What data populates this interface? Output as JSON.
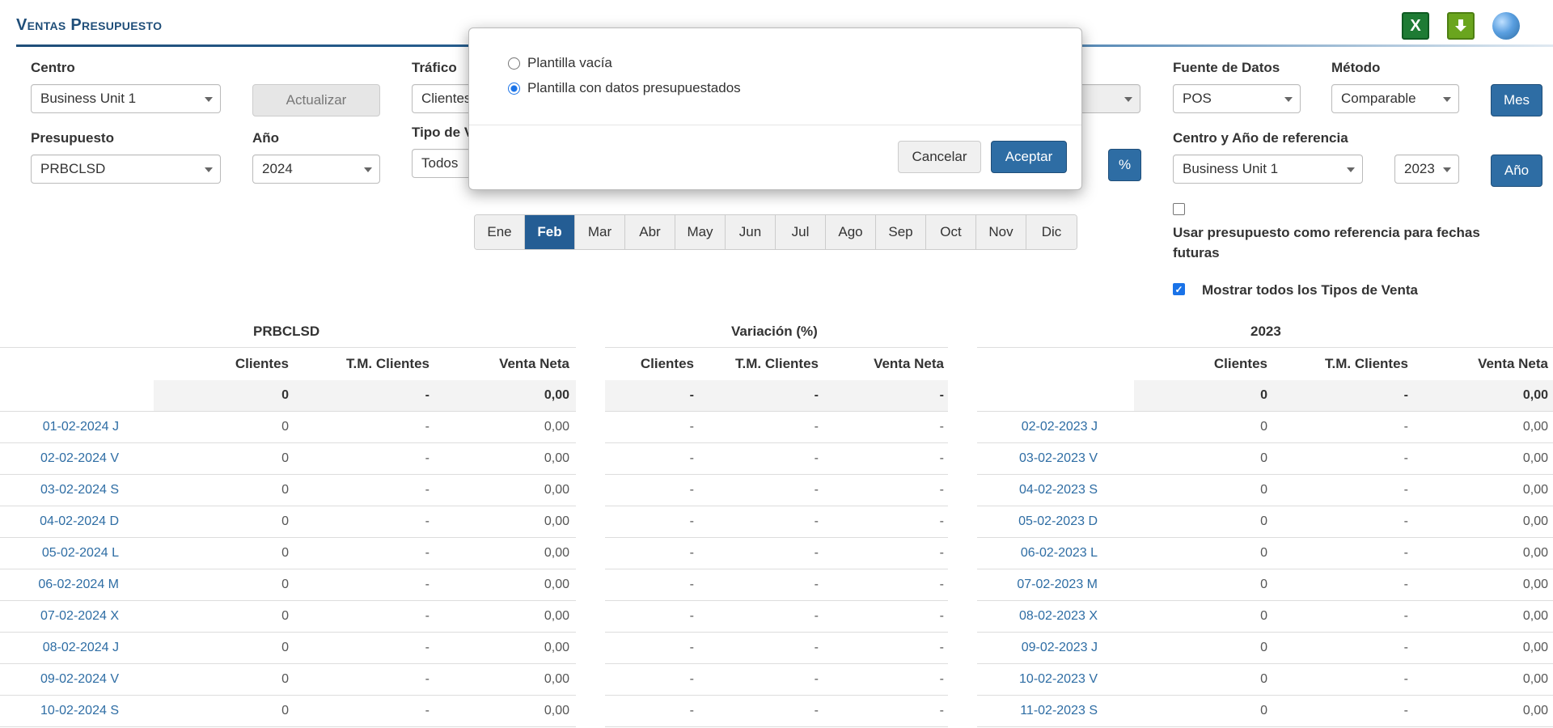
{
  "header": {
    "title": "Ventas Presupuesto"
  },
  "filters": {
    "centro": {
      "label": "Centro",
      "value": "Business Unit 1"
    },
    "actualizar": "Actualizar",
    "trafico": {
      "label": "Tráfico",
      "value": "Clientes"
    },
    "tipo_venta": {
      "label": "Tipo de V",
      "value": "Todos"
    },
    "presupuesto": {
      "label": "Presupuesto",
      "value": "PRBCLSD"
    },
    "anio": {
      "label": "Año",
      "value": "2024"
    },
    "fuente": {
      "label": "Fuente de Datos",
      "value": "POS"
    },
    "metodo": {
      "label": "Método",
      "value": "Comparable"
    },
    "mes_btn": "Mes",
    "pct_btn": "%",
    "ref": {
      "label": "Centro y Año de referencia",
      "centro": "Business Unit 1",
      "anio": "2023"
    },
    "anio_btn": "Año",
    "usar_ref": {
      "label": "Usar presupuesto como referencia para fechas futuras",
      "checked": false
    },
    "mostrar_tipos": {
      "label": "Mostrar todos los Tipos de Venta",
      "checked": true
    }
  },
  "months": [
    "Ene",
    "Feb",
    "Mar",
    "Abr",
    "May",
    "Jun",
    "Jul",
    "Ago",
    "Sep",
    "Oct",
    "Nov",
    "Dic"
  ],
  "active_month": "Feb",
  "tables": {
    "budget": {
      "title": "PRBCLSD",
      "columns": [
        "Clientes",
        "T.M. Clientes",
        "Venta Neta"
      ],
      "total": [
        "0",
        "-",
        "0,00"
      ],
      "rows": [
        {
          "date": "01-02-2024 J",
          "values": [
            "0",
            "-",
            "0,00"
          ]
        },
        {
          "date": "02-02-2024 V",
          "values": [
            "0",
            "-",
            "0,00"
          ]
        },
        {
          "date": "03-02-2024 S",
          "values": [
            "0",
            "-",
            "0,00"
          ]
        },
        {
          "date": "04-02-2024 D",
          "values": [
            "0",
            "-",
            "0,00"
          ]
        },
        {
          "date": "05-02-2024 L",
          "values": [
            "0",
            "-",
            "0,00"
          ]
        },
        {
          "date": "06-02-2024 M",
          "values": [
            "0",
            "-",
            "0,00"
          ]
        },
        {
          "date": "07-02-2024 X",
          "values": [
            "0",
            "-",
            "0,00"
          ]
        },
        {
          "date": "08-02-2024 J",
          "values": [
            "0",
            "-",
            "0,00"
          ]
        },
        {
          "date": "09-02-2024 V",
          "values": [
            "0",
            "-",
            "0,00"
          ]
        },
        {
          "date": "10-02-2024 S",
          "values": [
            "0",
            "-",
            "0,00"
          ]
        }
      ]
    },
    "variation": {
      "title": "Variación (%)",
      "columns": [
        "Clientes",
        "T.M. Clientes",
        "Venta Neta"
      ],
      "total": [
        "-",
        "-",
        "-"
      ],
      "rows": [
        [
          "-",
          "-",
          "-"
        ],
        [
          "-",
          "-",
          "-"
        ],
        [
          "-",
          "-",
          "-"
        ],
        [
          "-",
          "-",
          "-"
        ],
        [
          "-",
          "-",
          "-"
        ],
        [
          "-",
          "-",
          "-"
        ],
        [
          "-",
          "-",
          "-"
        ],
        [
          "-",
          "-",
          "-"
        ],
        [
          "-",
          "-",
          "-"
        ],
        [
          "-",
          "-",
          "-"
        ]
      ]
    },
    "reference": {
      "title": "2023",
      "columns": [
        "Clientes",
        "T.M. Clientes",
        "Venta Neta"
      ],
      "total": [
        "0",
        "-",
        "0,00"
      ],
      "rows": [
        {
          "date": "02-02-2023 J",
          "values": [
            "0",
            "-",
            "0,00"
          ]
        },
        {
          "date": "03-02-2023 V",
          "values": [
            "0",
            "-",
            "0,00"
          ]
        },
        {
          "date": "04-02-2023 S",
          "values": [
            "0",
            "-",
            "0,00"
          ]
        },
        {
          "date": "05-02-2023 D",
          "values": [
            "0",
            "-",
            "0,00"
          ]
        },
        {
          "date": "06-02-2023 L",
          "values": [
            "0",
            "-",
            "0,00"
          ]
        },
        {
          "date": "07-02-2023 M",
          "values": [
            "0",
            "-",
            "0,00"
          ]
        },
        {
          "date": "08-02-2023 X",
          "values": [
            "0",
            "-",
            "0,00"
          ]
        },
        {
          "date": "09-02-2023 J",
          "values": [
            "0",
            "-",
            "0,00"
          ]
        },
        {
          "date": "10-02-2023 V",
          "values": [
            "0",
            "-",
            "0,00"
          ]
        },
        {
          "date": "11-02-2023 S",
          "values": [
            "0",
            "-",
            "0,00"
          ]
        }
      ]
    }
  },
  "modal": {
    "options": [
      {
        "label": "Plantilla vacía",
        "selected": false
      },
      {
        "label": "Plantilla con datos presupuestados",
        "selected": true
      }
    ],
    "cancel": "Cancelar",
    "accept": "Aceptar"
  },
  "icons": {
    "excel": "excel-icon",
    "download": "download-icon",
    "globe": "globe-icon"
  },
  "colors": {
    "primary": "#2e6da4",
    "title": "#1f4e79",
    "link": "#2e6da4"
  }
}
